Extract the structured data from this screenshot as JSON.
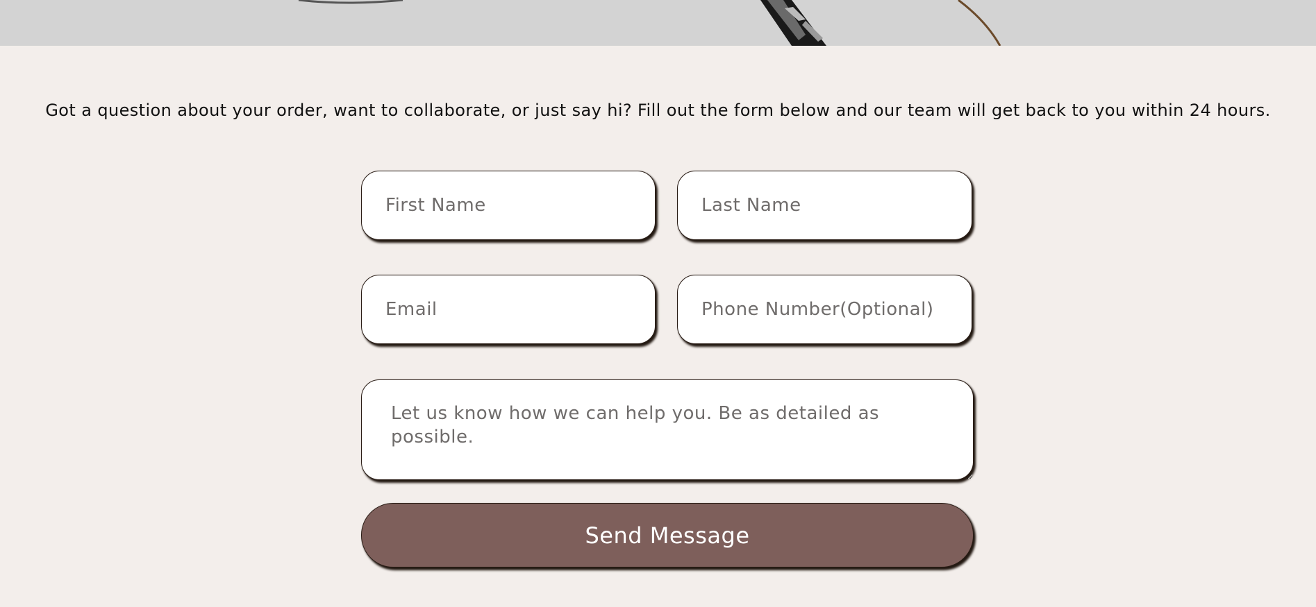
{
  "intro": {
    "text": "Got a question about your order, want to collaborate, or just say hi? Fill out the form below and our team will get back to you within 24 hours."
  },
  "form": {
    "first_name": {
      "placeholder": "First Name",
      "value": ""
    },
    "last_name": {
      "placeholder": "Last Name",
      "value": ""
    },
    "email": {
      "placeholder": "Email",
      "value": ""
    },
    "phone": {
      "placeholder": "Phone Number(Optional)",
      "value": ""
    },
    "message": {
      "placeholder": "Let us know how we can help you. Be as detailed as possible.",
      "value": ""
    },
    "submit_label": "Send Message"
  },
  "colors": {
    "page_background": "#f3eeeb",
    "hero_strip": "#d3d3d3",
    "button_background": "#7e5f5b",
    "button_text": "#ffffff",
    "field_shadow": "#231912"
  }
}
